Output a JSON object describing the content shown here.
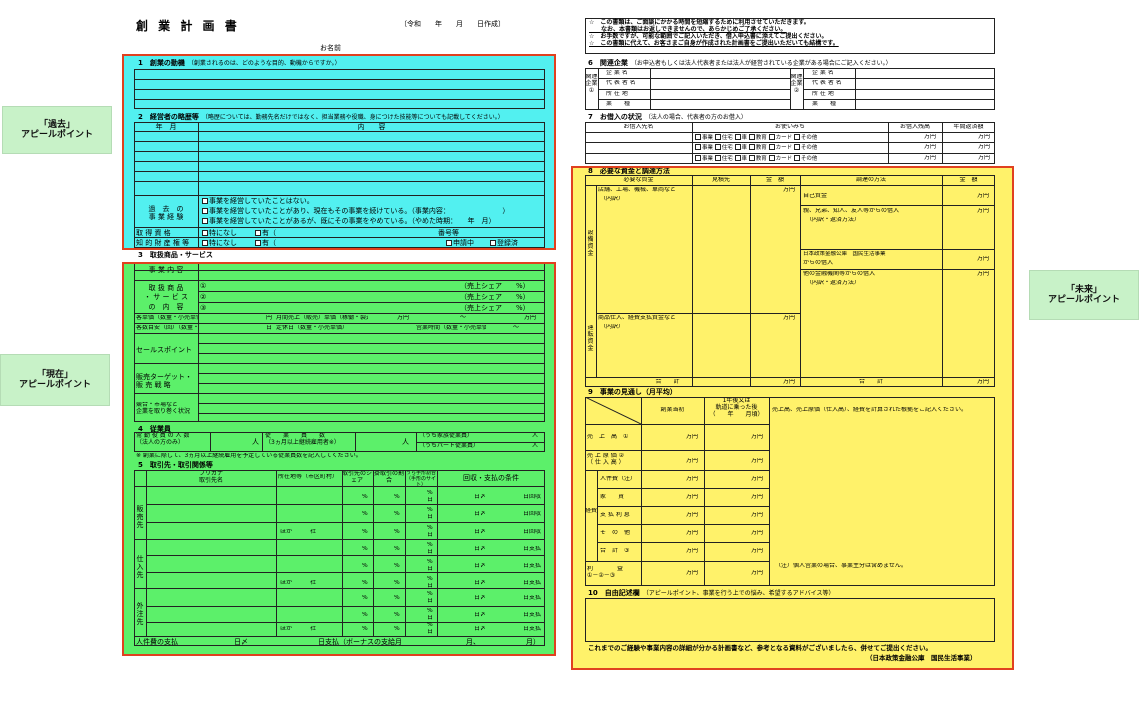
{
  "colors": {
    "past": "#52f0f0",
    "present": "#5cf06a",
    "future": "#fff26a",
    "frame": "#e0411f",
    "caption_bg": "#c8f2c8"
  },
  "header": {
    "title": "創 業 計 画 書",
    "date_label": "〔令和　　年　　月　　日作成〕",
    "name_label": "お名前"
  },
  "captions": {
    "past": {
      "line1": "「過去」",
      "line2": "アピールポイント"
    },
    "present": {
      "line1": "「現在」",
      "line2": "アピールポイント"
    },
    "future": {
      "line1": "「未来」",
      "line2": "アピールポイント"
    }
  },
  "notice": {
    "l1": "☆　この書類は、ご面談にかかる時間を短縮するために利用させていただきます。",
    "l2": "　　なお、本書類はお返しできませんので、あらかじめご了承ください。",
    "l3": "☆　お手数ですが、可能な範囲でご記入いただき、借入申込書に添えてご提出ください。",
    "l4": "☆　この書類に代えて、お客さまご自身が作成された計画書をご提出いただいても結構です。"
  },
  "sec1": {
    "title": "1　創業の動機",
    "sub": "（創業されるのは、どのような目的、動機からですか。）"
  },
  "sec2": {
    "title": "2　経営者の略歴等",
    "sub": "（略歴については、勤務先名だけではなく、担当業務や役職、身につけた技能等についても記載してください。）",
    "col_date": "年　月",
    "col_content": "内　　容",
    "exp_label1": "過　去　の",
    "exp_label2": "事 業 経 験",
    "exp1": "事業を経営していたことはない。",
    "exp2": "事業を経営していたことがあり、現在もその事業を続けている。（事業内容：　　　　　　　　）",
    "exp3": "事業を経営していたことがあるが、既にその事業をやめている。（やめた時期：　　年　月）",
    "qual_label": "取 得 資 格",
    "qual_none": "特になし",
    "qual_yes": "有（",
    "qual_num": "番号等",
    "ip_label": "知 的 財 産 権 等",
    "ip_none": "特になし",
    "ip_yes": "有（",
    "ip_apply": "申請中",
    "ip_reg": "登録済"
  },
  "sec3": {
    "title": "3　取扱商品・サービス",
    "content_label": "事 業 内 容",
    "prod_label1": "取 扱 商 品",
    "prod_label2": "・ サ ー ビ ス",
    "prod_label3": "の　内　容",
    "prod": [
      "①",
      "②",
      "③"
    ],
    "share": "（売上シェア　　%）",
    "unit_label": "客単価（数量・小売単価）",
    "unit_yen": "円",
    "unit_sales": "月間売上（販売）単価（稼働・製造等）",
    "manyen": "万円",
    "tilde": "〜",
    "cust_label": "客数目安（回）（数量・小売単価）",
    "day": "日",
    "holiday": "定休日（数量・小売単価）",
    "hours": "営業時間（数量・小売単価）",
    "sales_point": "セールスポイント",
    "target1": "販売ターゲット・",
    "target2": "販 売 戦 略",
    "compete1": "競合・市場など",
    "compete2": "企業を取り巻く状況"
  },
  "sec4": {
    "title": "4　従業員",
    "full1": "常 勤 役 員 の 人 数",
    "full2": "（法人の方のみ）",
    "person": "人",
    "emp1": "従　　業　　員　　数",
    "emp2": "（3ヵ月以上継続雇用者※）",
    "family": "（うち家族従業員）",
    "part": "（うちパート従業員）",
    "note": "※ 創業に際して、3ヵ月以上継続雇用を予定している従業員数を記入してください。"
  },
  "sec5": {
    "title": "5　取引先・取引関係等",
    "furigana": "フリガナ",
    "name": "取引先名",
    "addr": "所在地等（市区町村）",
    "share": "取引先のシェア",
    "cash": "掛取引の割合",
    "kake": "うち手形割合（手形のサイト）",
    "cond": "回収・支払の条件",
    "sales": "販売先",
    "supply": "仕入先",
    "outsource": "外注先",
    "others": "ほか　　　社",
    "pct": "%",
    "days": "日",
    "dayslash": "日〆",
    "collect": "日回収",
    "pay": "日支払",
    "wage": "人件費の支払",
    "wage_mid": "日〆",
    "wage_pay": "日支払（ボーナスの支給月",
    "wage_month": "月、",
    "wage_end": "月）"
  },
  "sec6": {
    "title": "6　関連企業",
    "sub": "（お申込者もしくは法人代表者または法人が経営されている企業がある場合にご記入ください。）",
    "side_l": "関連企業①",
    "side_r": "関連企業②",
    "rows": [
      "企 業 名",
      "代 表 者 名",
      "所 在 地",
      "業　　種"
    ]
  },
  "sec7": {
    "title": "7　お借入の状況",
    "sub": "（法人の場合、代表者の方のお借入）",
    "lender": "お借入先名",
    "usage": "お使いみち",
    "balance": "お借入残高",
    "annual": "年間返済額",
    "uses": [
      "事業",
      "住宅",
      "車",
      "教育",
      "カード",
      "その他"
    ],
    "manyen": "万円"
  },
  "sec8": {
    "title": "8　必要な資金と調達方法",
    "need": "必要な資金",
    "quote": "見積先",
    "amount": "金　額",
    "method": "調達の方法",
    "amount2": "金　額",
    "equip": "設備資金",
    "equip_item": "店舗、工場、機械、車両など",
    "detail": "（内訳）",
    "operate": "運転資金",
    "operate_item": "商品仕入、経費支払資金など",
    "own": "自己資金",
    "family": "親、兄弟、知人、友人等からの借入",
    "family_sub": "（内訳・返済方法）",
    "jfc1": "日本政策金融公庫　国民生活事業",
    "jfc2": "からの借入",
    "other": "他の金融機関等からの借入",
    "other_sub": "（内訳・返済方法）",
    "total": "合　　計",
    "manyen": "万円"
  },
  "sec9": {
    "title": "9　事業の見通し（月平均）",
    "start": "創業当初",
    "after1": "1年後又は",
    "after2": "軌道に乗った後",
    "after3": "（　　年　　月頃）",
    "basis": "売上高、売上原価（仕入高）、経費を計算された根拠をご記入ください。",
    "sales": "売　上　高　①",
    "cost1": "売 上 原 価 ②",
    "cost2": "（ 仕 入 高 ）",
    "expense": "経費",
    "items": [
      "人件費（注）",
      "家　　賃",
      "支 払 利 息",
      "そ　の　他",
      "合　計　③"
    ],
    "profit1": "利　　　　益",
    "profit2": "①－②－③",
    "note": "（注）個人営業の場合、事業主分は含めません。",
    "manyen": "万円"
  },
  "sec10": {
    "title": "10　自由記述欄",
    "sub": "（アピールポイント、事業を行う上での悩み、希望するアドバイス等）"
  },
  "footer": {
    "l1": "これまでのご経験や事業内容の詳細が分かる計画書など、参考となる資料がございましたら、併せてご提出ください。",
    "l2": "（日本政策金融公庫　国民生活事業）"
  }
}
